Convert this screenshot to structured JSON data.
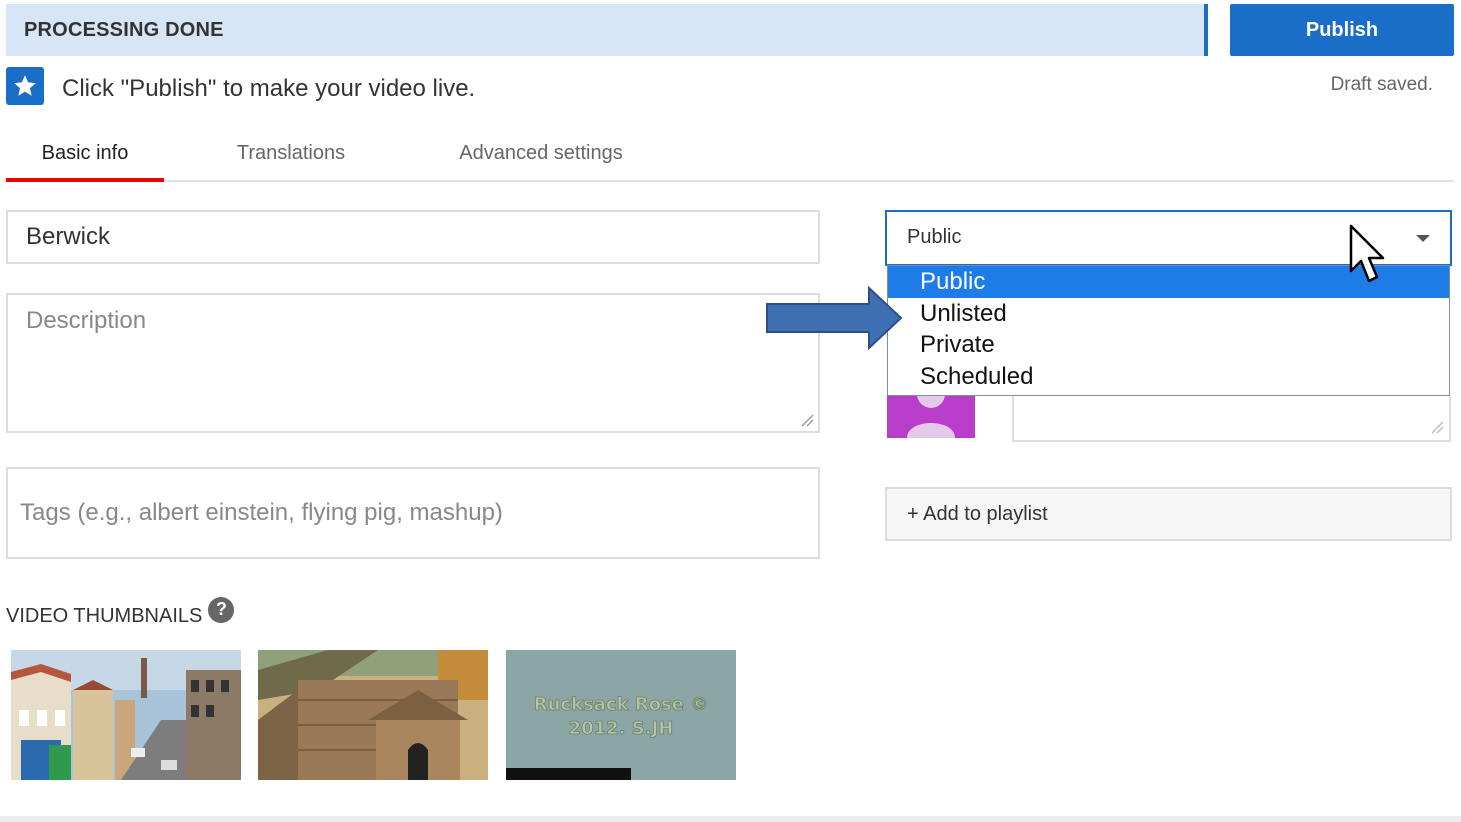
{
  "header": {
    "status": "PROCESSING DONE",
    "publish_label": "Publish"
  },
  "notice": {
    "icon": "star-icon",
    "text": "Click \"Publish\" to make your video live.",
    "draft_status": "Draft saved."
  },
  "tabs": [
    {
      "label": "Basic info",
      "active": true
    },
    {
      "label": "Translations",
      "active": false
    },
    {
      "label": "Advanced settings",
      "active": false
    }
  ],
  "form": {
    "title_value": "Berwick",
    "description_placeholder": "Description",
    "tags_placeholder": "Tags (e.g., albert einstein, flying pig, mashup)"
  },
  "privacy": {
    "selected": "Public",
    "options": [
      "Public",
      "Unlisted",
      "Private",
      "Scheduled"
    ]
  },
  "playlist": {
    "label": "+ Add to playlist"
  },
  "thumbnails": {
    "heading": "VIDEO THUMBNAILS",
    "help_glyph": "?",
    "caption": "Rucksack Rose ©\n2012. S.JH"
  },
  "colors": {
    "accent": "#1a6ec7",
    "status_bg": "#d6e6f6",
    "tab_underline": "#ee0000",
    "option_highlight": "#1e7ce8"
  }
}
